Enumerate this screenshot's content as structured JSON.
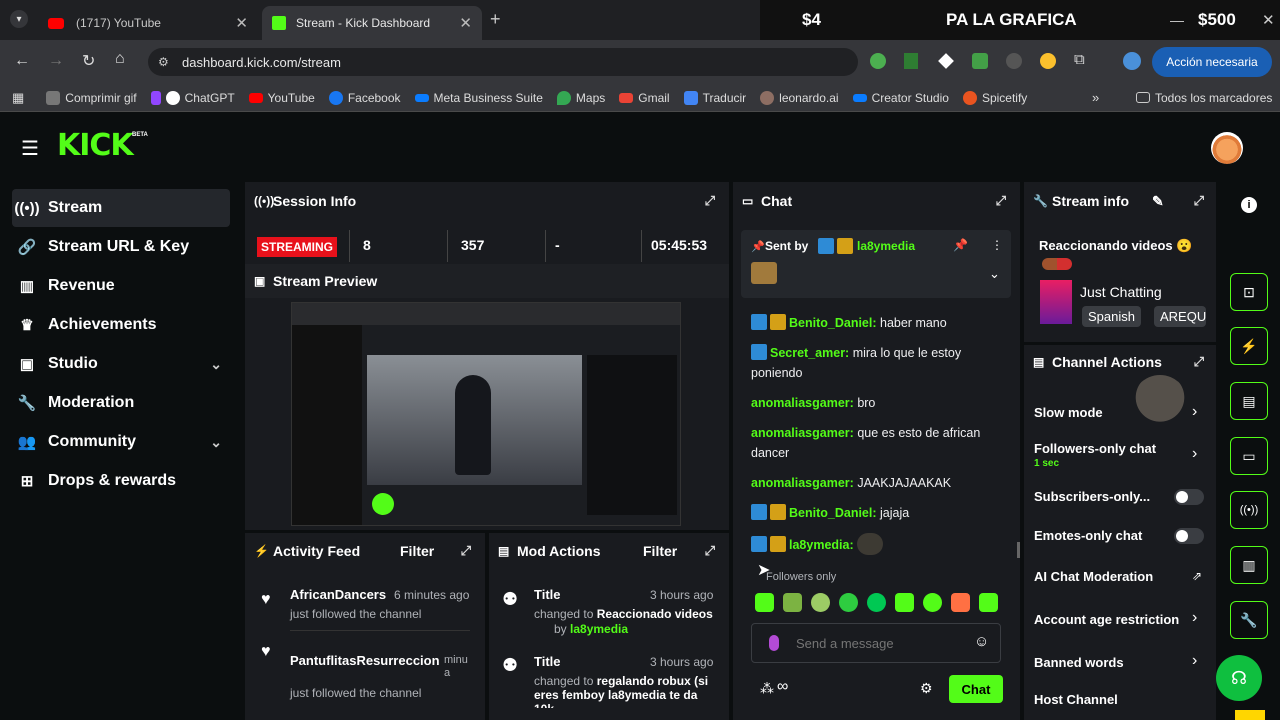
{
  "browser": {
    "tabs": [
      {
        "label": "(1717) YouTube"
      },
      {
        "label": "Stream - Kick Dashboard"
      }
    ],
    "overlay": {
      "left": "$4",
      "center": "PA LA GRAFICA",
      "right": "$500"
    },
    "url": "dashboard.kick.com/stream",
    "action_button": "Acción necesaria",
    "bookmarks": [
      "Comprimir gif",
      "ChatGPT",
      "YouTube",
      "Facebook",
      "Meta Business Suite",
      "Maps",
      "Gmail",
      "Traducir",
      "leonardo.ai",
      "Creator Studio",
      "Spicetify"
    ],
    "all_bookmarks": "Todos los marcadores"
  },
  "kick": {
    "logo": "KICK",
    "logo_badge": "BETA",
    "nav": [
      {
        "label": "Stream"
      },
      {
        "label": "Stream URL & Key"
      },
      {
        "label": "Revenue"
      },
      {
        "label": "Achievements"
      },
      {
        "label": "Studio"
      },
      {
        "label": "Moderation"
      },
      {
        "label": "Community"
      },
      {
        "label": "Drops & rewards"
      }
    ],
    "session": {
      "title": "Session Info",
      "status": "STREAMING",
      "v1": "8",
      "v2": "357",
      "v3": "-",
      "time": "05:45:53"
    },
    "preview": {
      "title": "Stream Preview"
    },
    "activity": {
      "title": "Activity Feed",
      "filter": "Filter",
      "items": [
        {
          "user": "AfricanDancers",
          "time": "6 minutes ago",
          "text": "just followed the channel"
        },
        {
          "user": "PantuflitasResurreccion",
          "time": "minu a",
          "text": "just followed the channel"
        }
      ]
    },
    "mod": {
      "title": "Mod Actions",
      "filter": "Filter",
      "items": [
        {
          "title": "Title",
          "time": "3 hours ago",
          "changed": "changed to",
          "value": "Reaccionado videos",
          "by": "by",
          "user": "la8ymedia"
        },
        {
          "title": "Title",
          "time": "3 hours ago",
          "changed": "changed to",
          "value": "regalando robux (si eres femboy la8ymedia te da 10k",
          "by": "",
          "user": ""
        }
      ]
    },
    "chat": {
      "title": "Chat",
      "pinned_by": "Sent by",
      "pinned_user": "la8ymedia",
      "messages": [
        {
          "user": "Benito_Daniel:",
          "text": "haber mano"
        },
        {
          "user": "Secret_amer:",
          "text": "mira lo que le estoy poniendo"
        },
        {
          "user": "anomaliasgamer:",
          "text": "bro"
        },
        {
          "user": "anomaliasgamer:",
          "text": "que es esto de african dancer"
        },
        {
          "user": "anomaliasgamer:",
          "text": "JAAKJAJAAKAK"
        },
        {
          "user": "Benito_Daniel:",
          "text": "jajaja"
        },
        {
          "user": "la8ymedia:",
          "text": ""
        }
      ],
      "followers_only": "Followers only",
      "placeholder": "Send a message",
      "send": "Chat",
      "infinity": "∞"
    },
    "stream_info": {
      "title": "Stream info",
      "stream_title": "Reaccionando videos 😮",
      "category": "Just Chatting",
      "tags": [
        "Spanish",
        "AREQU"
      ]
    },
    "channel_actions": {
      "title": "Channel Actions",
      "items": [
        {
          "label": "Slow mode"
        },
        {
          "label": "Followers-only chat",
          "sub": "1 sec"
        },
        {
          "label": "Subscribers-only..."
        },
        {
          "label": "Emotes-only chat"
        },
        {
          "label": "AI Chat Moderation"
        },
        {
          "label": "Account age restriction"
        },
        {
          "label": "Banned words"
        },
        {
          "label": "Host Channel"
        }
      ]
    },
    "colors": {
      "accent": "#53fc18",
      "panel": "#191b1f",
      "bg": "#0b0e0f",
      "streaming": "#e8111b"
    }
  }
}
